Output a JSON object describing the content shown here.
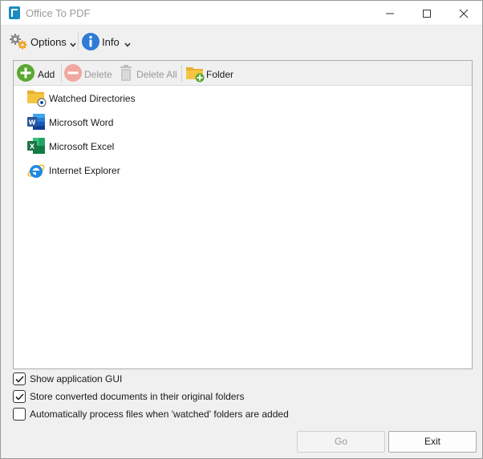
{
  "window": {
    "title": "Office To PDF",
    "icon": "app-icon",
    "controls": {
      "minimize": "minimize-icon",
      "maximize": "maximize-icon",
      "close": "close-icon"
    }
  },
  "menu": {
    "options_label": "Options",
    "info_label": "Info"
  },
  "toolbar": {
    "add_label": "Add",
    "delete_label": "Delete",
    "delete_all_label": "Delete All",
    "folder_label": "Folder"
  },
  "tree": {
    "items": [
      {
        "label": "Watched Directories",
        "icon": "watched-folder-icon"
      },
      {
        "label": "Microsoft Word",
        "icon": "word-icon"
      },
      {
        "label": "Microsoft Excel",
        "icon": "excel-icon"
      },
      {
        "label": "Internet Explorer",
        "icon": "internet-explorer-icon"
      }
    ]
  },
  "options": {
    "show_gui": {
      "label": "Show application GUI",
      "checked": true
    },
    "store_original": {
      "label": "Store converted documents in their original folders",
      "checked": true
    },
    "auto_process": {
      "label": "Automatically process files when 'watched' folders are added",
      "checked": false
    }
  },
  "buttons": {
    "go_label": "Go",
    "exit_label": "Exit"
  },
  "colors": {
    "accent_blue": "#2f7bd6",
    "add_green": "#5aa832",
    "delete_red_disabled": "#f0a8a0",
    "folder_yellow": "#f5c542",
    "word_blue": "#2b579a",
    "excel_green": "#217346",
    "disabled_text": "#9a9a9a"
  }
}
